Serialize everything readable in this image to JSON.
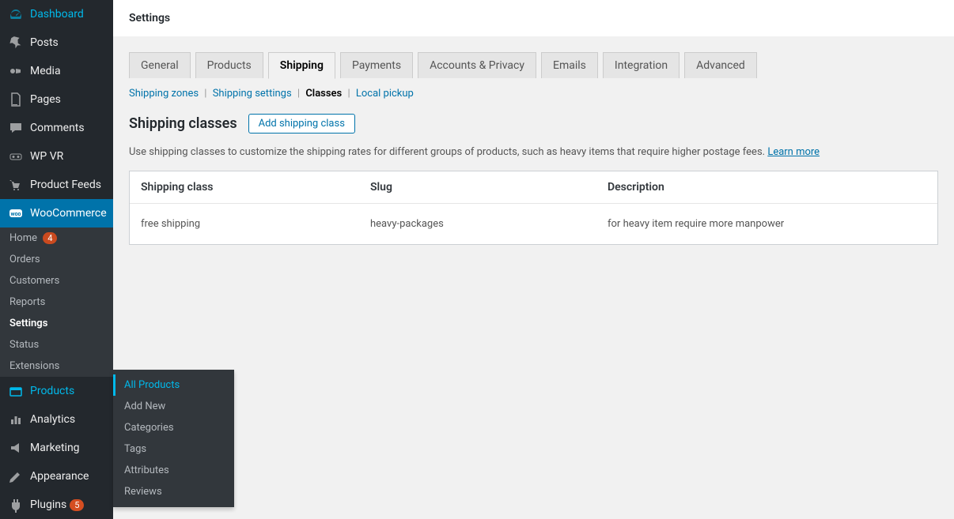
{
  "sidebar": {
    "items": [
      {
        "label": "Dashboard",
        "icon": "dashboard"
      },
      {
        "label": "Posts",
        "icon": "pin"
      },
      {
        "label": "Media",
        "icon": "media"
      },
      {
        "label": "Pages",
        "icon": "pages"
      },
      {
        "label": "Comments",
        "icon": "comments"
      },
      {
        "label": "WP VR",
        "icon": "vr"
      },
      {
        "label": "Product Feeds",
        "icon": "feed"
      },
      {
        "label": "WooCommerce",
        "icon": "woo"
      },
      {
        "label": "Products",
        "icon": "products"
      },
      {
        "label": "Analytics",
        "icon": "analytics"
      },
      {
        "label": "Marketing",
        "icon": "marketing"
      },
      {
        "label": "Appearance",
        "icon": "appearance"
      },
      {
        "label": "Plugins",
        "icon": "plugins"
      }
    ],
    "home_badge": "4",
    "plugins_badge": "5",
    "woo_submenu": [
      "Home",
      "Orders",
      "Customers",
      "Reports",
      "Settings",
      "Status",
      "Extensions"
    ],
    "products_flyout": [
      "All Products",
      "Add New",
      "Categories",
      "Tags",
      "Attributes",
      "Reviews"
    ]
  },
  "header": {
    "title": "Settings"
  },
  "tabs": [
    "General",
    "Products",
    "Shipping",
    "Payments",
    "Accounts & Privacy",
    "Emails",
    "Integration",
    "Advanced"
  ],
  "subtabs": {
    "shipping_zones": "Shipping zones",
    "shipping_settings": "Shipping settings",
    "classes": "Classes",
    "local_pickup": "Local pickup"
  },
  "section": {
    "title": "Shipping classes",
    "button": "Add shipping class",
    "description": "Use shipping classes to customize the shipping rates for different groups of products, such as heavy items that require higher postage fees.",
    "learn_more": "Learn more"
  },
  "table": {
    "headers": {
      "class": "Shipping class",
      "slug": "Slug",
      "description": "Description"
    },
    "rows": [
      {
        "class": "free shipping",
        "slug": "heavy-packages",
        "description": "for heavy item require more manpower"
      }
    ]
  }
}
